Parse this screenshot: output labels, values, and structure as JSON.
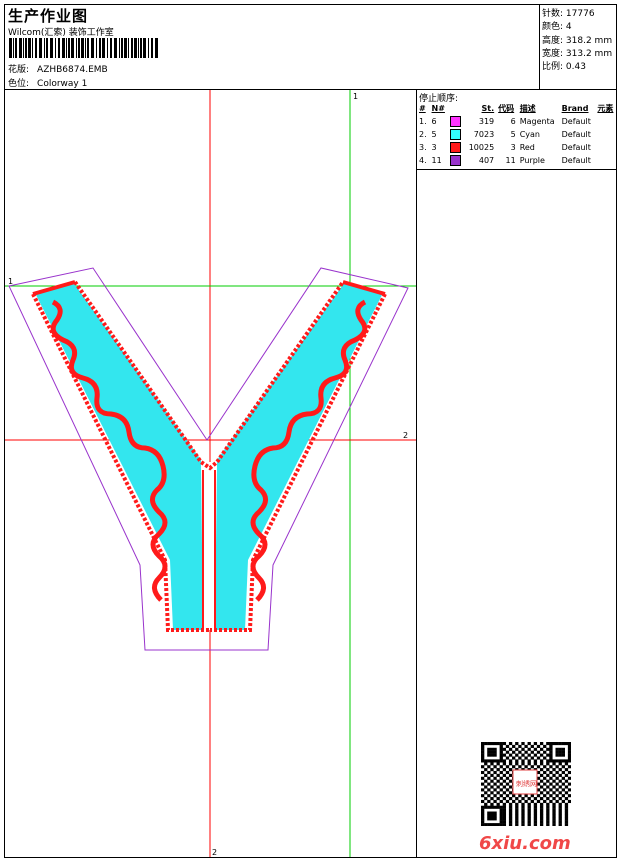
{
  "header": {
    "title": "生产作业图",
    "company": "Wilcom(汇索) 装饰工作室",
    "design_label": "花版:",
    "design_value": "AZHB6874.EMB",
    "colorway_label": "色位:",
    "colorway_value": "Colorway 1"
  },
  "stats": [
    {
      "label": "针数:",
      "value": "17776"
    },
    {
      "label": "颜色:",
      "value": "4"
    },
    {
      "label": "高度:",
      "value": "318.2 mm"
    },
    {
      "label": "宽度:",
      "value": "313.2 mm"
    },
    {
      "label": "比例:",
      "value": "0.43"
    }
  ],
  "stop_sequence": {
    "caption": "停止顺序:",
    "columns": [
      "#",
      "N#",
      "",
      "St.",
      "代码",
      "描述",
      "Brand",
      "元素"
    ],
    "rows": [
      {
        "idx": "1.",
        "needle": "6",
        "color": "#ff33ff",
        "stitches": "319",
        "code": "6",
        "desc": "Magenta",
        "brand": "Default"
      },
      {
        "idx": "2.",
        "needle": "5",
        "color": "#33ffff",
        "stitches": "7023",
        "code": "5",
        "desc": "Cyan",
        "brand": "Default"
      },
      {
        "idx": "3.",
        "needle": "3",
        "color": "#ff1a1a",
        "stitches": "10025",
        "code": "3",
        "desc": "Red",
        "brand": "Default"
      },
      {
        "idx": "4.",
        "needle": "11",
        "color": "#9933cc",
        "stitches": "407",
        "code": "11",
        "desc": "Purple",
        "brand": "Default"
      }
    ]
  },
  "guides": {
    "v1": "1",
    "v2": "2",
    "h1": "1",
    "h2": "2"
  },
  "watermark": "6xiu.com",
  "qr_stamp": "刺绣网",
  "colors": {
    "guide_red": "#ff0000",
    "guide_green": "#00cc00",
    "outline": "#9933cc",
    "fill": "#33e6ee",
    "satin": "#ff1a1a"
  }
}
